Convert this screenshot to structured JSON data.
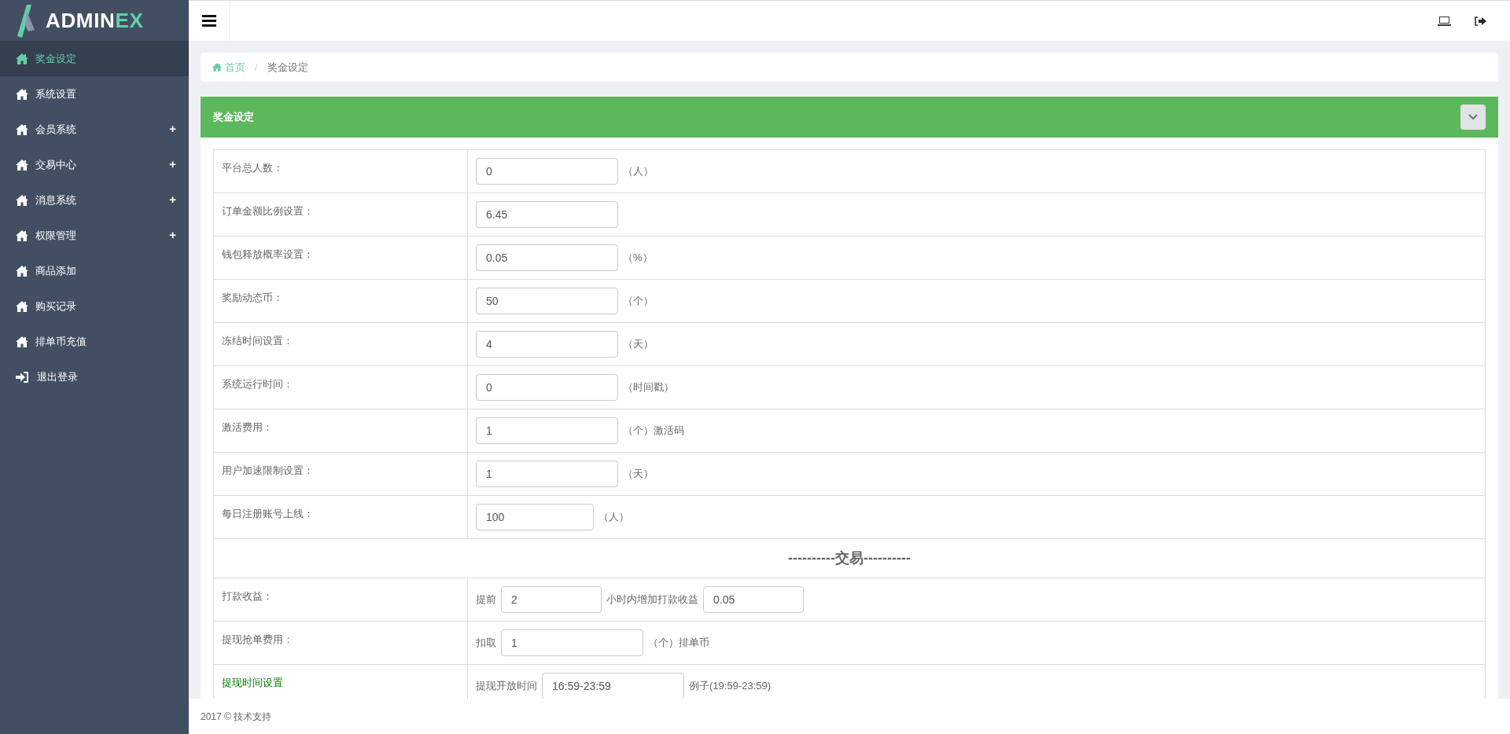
{
  "logo": {
    "part1": "ADMIN",
    "part2": "EX"
  },
  "sidebar": {
    "items": [
      {
        "kind": "page",
        "label": "奖金设定",
        "selected": true
      },
      {
        "kind": "page",
        "label": "系统设置",
        "selected": false
      },
      {
        "kind": "page",
        "label": "会员系统",
        "selected": false,
        "toggle": "+"
      },
      {
        "kind": "page",
        "label": "交易中心",
        "selected": false,
        "toggle": "+"
      },
      {
        "kind": "page",
        "label": "消息系统",
        "selected": false,
        "toggle": "+"
      },
      {
        "kind": "page",
        "label": "权限管理",
        "selected": false,
        "toggle": "+"
      },
      {
        "kind": "page",
        "label": "商品添加",
        "selected": false
      },
      {
        "kind": "page",
        "label": "购买记录",
        "selected": false
      },
      {
        "kind": "page",
        "label": "排单币充值",
        "selected": false
      },
      {
        "kind": "logout",
        "label": "退出登录",
        "selected": false
      }
    ]
  },
  "breadcrumb": {
    "separator": "/",
    "items": [
      {
        "kind": "home",
        "label": "首页"
      },
      {
        "kind": "current",
        "label": "奖金设定"
      }
    ]
  },
  "panel": {
    "title": "奖金设定"
  },
  "rows": [
    {
      "kind": "field",
      "label": "平台总人数：",
      "highlighted": false,
      "parts": [
        {
          "kind": "input",
          "value": "0"
        },
        {
          "kind": "text",
          "text": "（人）"
        }
      ]
    },
    {
      "kind": "field",
      "label": "订单金额比例设置：",
      "highlighted": false,
      "parts": [
        {
          "kind": "input",
          "value": "6.45"
        }
      ]
    },
    {
      "kind": "field",
      "label": "钱包释放概率设置：",
      "highlighted": false,
      "parts": [
        {
          "kind": "input",
          "value": "0.05"
        },
        {
          "kind": "text",
          "text": "（%）"
        }
      ]
    },
    {
      "kind": "field",
      "label": "奖励动态币：",
      "highlighted": false,
      "parts": [
        {
          "kind": "input",
          "value": "50"
        },
        {
          "kind": "text",
          "text": "（个）"
        }
      ]
    },
    {
      "kind": "field",
      "label": "冻结时间设置：",
      "highlighted": false,
      "parts": [
        {
          "kind": "input",
          "value": "4"
        },
        {
          "kind": "text",
          "text": "（天）"
        }
      ]
    },
    {
      "kind": "field",
      "label": "系统运行时间：",
      "highlighted": false,
      "parts": [
        {
          "kind": "input",
          "value": "0"
        },
        {
          "kind": "text",
          "text": "（时间戳）"
        }
      ]
    },
    {
      "kind": "field",
      "label": "激活费用：",
      "highlighted": false,
      "parts": [
        {
          "kind": "input",
          "value": "1"
        },
        {
          "kind": "text",
          "text": "（个）激活码"
        }
      ]
    },
    {
      "kind": "field",
      "label": "用户加速限制设置：",
      "highlighted": false,
      "parts": [
        {
          "kind": "input",
          "value": "1"
        },
        {
          "kind": "text",
          "text": "（天）"
        }
      ]
    },
    {
      "kind": "field",
      "label": "每日注册账号上线：",
      "highlighted": false,
      "parts": [
        {
          "kind": "short-input",
          "value": "100"
        },
        {
          "kind": "text",
          "text": "（人）"
        }
      ]
    },
    {
      "kind": "section",
      "label": "----------交易----------"
    },
    {
      "kind": "field",
      "label": "打款收益：",
      "highlighted": false,
      "parts": [
        {
          "kind": "text",
          "text": "提前"
        },
        {
          "kind": "small-input",
          "value": "2"
        },
        {
          "kind": "text",
          "text": "小时内增加打款收益"
        },
        {
          "kind": "small-input",
          "value": "0.05"
        }
      ]
    },
    {
      "kind": "field",
      "label": "提现抢单费用：",
      "highlighted": false,
      "parts": [
        {
          "kind": "text",
          "text": "扣取"
        },
        {
          "kind": "input",
          "value": "1"
        },
        {
          "kind": "text",
          "text": "（个）排单币"
        }
      ]
    },
    {
      "kind": "field",
      "label": "提现时间设置",
      "highlighted": true,
      "parts": [
        {
          "kind": "text",
          "text": "提现开放时间"
        },
        {
          "kind": "input",
          "value": "16:59-23:59"
        },
        {
          "kind": "text",
          "text": "例子(19:59-23:59)"
        }
      ]
    }
  ],
  "footer": "2017 © 技术支持"
}
